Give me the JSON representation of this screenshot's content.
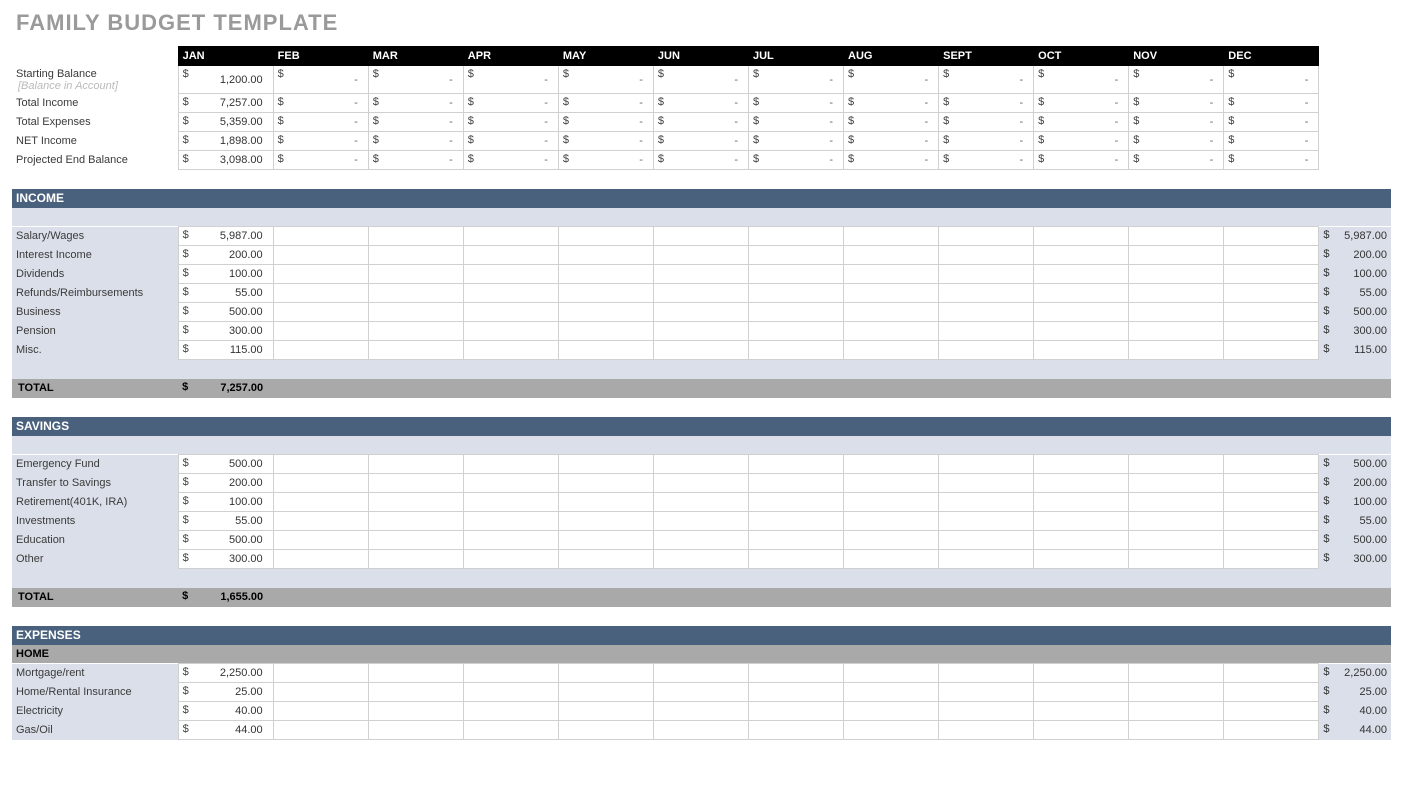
{
  "title": "FAMILY BUDGET TEMPLATE",
  "months": [
    "JAN",
    "FEB",
    "MAR",
    "APR",
    "MAY",
    "JUN",
    "JUL",
    "AUG",
    "SEPT",
    "OCT",
    "NOV",
    "DEC"
  ],
  "summary": {
    "starting_balance": {
      "label": "Starting Balance",
      "sublabel": "[Balance in Account]",
      "values": [
        "1,200.00",
        "-",
        "-",
        "-",
        "-",
        "-",
        "-",
        "-",
        "-",
        "-",
        "-",
        "-"
      ]
    },
    "total_income": {
      "label": "Total Income",
      "values": [
        "7,257.00",
        "-",
        "-",
        "-",
        "-",
        "-",
        "-",
        "-",
        "-",
        "-",
        "-",
        "-"
      ]
    },
    "total_expenses": {
      "label": "Total Expenses",
      "values": [
        "5,359.00",
        "-",
        "-",
        "-",
        "-",
        "-",
        "-",
        "-",
        "-",
        "-",
        "-",
        "-"
      ]
    },
    "net_income": {
      "label": "NET Income",
      "values": [
        "1,898.00",
        "-",
        "-",
        "-",
        "-",
        "-",
        "-",
        "-",
        "-",
        "-",
        "-",
        "-"
      ]
    },
    "projected_end": {
      "label": "Projected End Balance",
      "values": [
        "3,098.00",
        "-",
        "-",
        "-",
        "-",
        "-",
        "-",
        "-",
        "-",
        "-",
        "-",
        "-"
      ]
    }
  },
  "sections": {
    "income": {
      "title": "INCOME",
      "rows": [
        {
          "label": "Salary/Wages",
          "jan": "5,987.00",
          "total": "5,987.00"
        },
        {
          "label": "Interest Income",
          "jan": "200.00",
          "total": "200.00"
        },
        {
          "label": "Dividends",
          "jan": "100.00",
          "total": "100.00"
        },
        {
          "label": "Refunds/Reimbursements",
          "jan": "55.00",
          "total": "55.00"
        },
        {
          "label": "Business",
          "jan": "500.00",
          "total": "500.00"
        },
        {
          "label": "Pension",
          "jan": "300.00",
          "total": "300.00"
        },
        {
          "label": "Misc.",
          "jan": "115.00",
          "total": "115.00"
        }
      ],
      "total_label": "TOTAL",
      "total_jan": "7,257.00"
    },
    "savings": {
      "title": "SAVINGS",
      "rows": [
        {
          "label": "Emergency Fund",
          "jan": "500.00",
          "total": "500.00"
        },
        {
          "label": "Transfer to Savings",
          "jan": "200.00",
          "total": "200.00"
        },
        {
          "label": "Retirement(401K, IRA)",
          "jan": "100.00",
          "total": "100.00"
        },
        {
          "label": "Investments",
          "jan": "55.00",
          "total": "55.00"
        },
        {
          "label": "Education",
          "jan": "500.00",
          "total": "500.00"
        },
        {
          "label": "Other",
          "jan": "300.00",
          "total": "300.00"
        }
      ],
      "total_label": "TOTAL",
      "total_jan": "1,655.00"
    },
    "expenses": {
      "title": "EXPENSES",
      "subtitle": "HOME",
      "rows": [
        {
          "label": "Mortgage/rent",
          "jan": "2,250.00",
          "total": "2,250.00"
        },
        {
          "label": "Home/Rental Insurance",
          "jan": "25.00",
          "total": "25.00"
        },
        {
          "label": "Electricity",
          "jan": "40.00",
          "total": "40.00"
        },
        {
          "label": "Gas/Oil",
          "jan": "44.00",
          "total": "44.00"
        }
      ]
    }
  }
}
